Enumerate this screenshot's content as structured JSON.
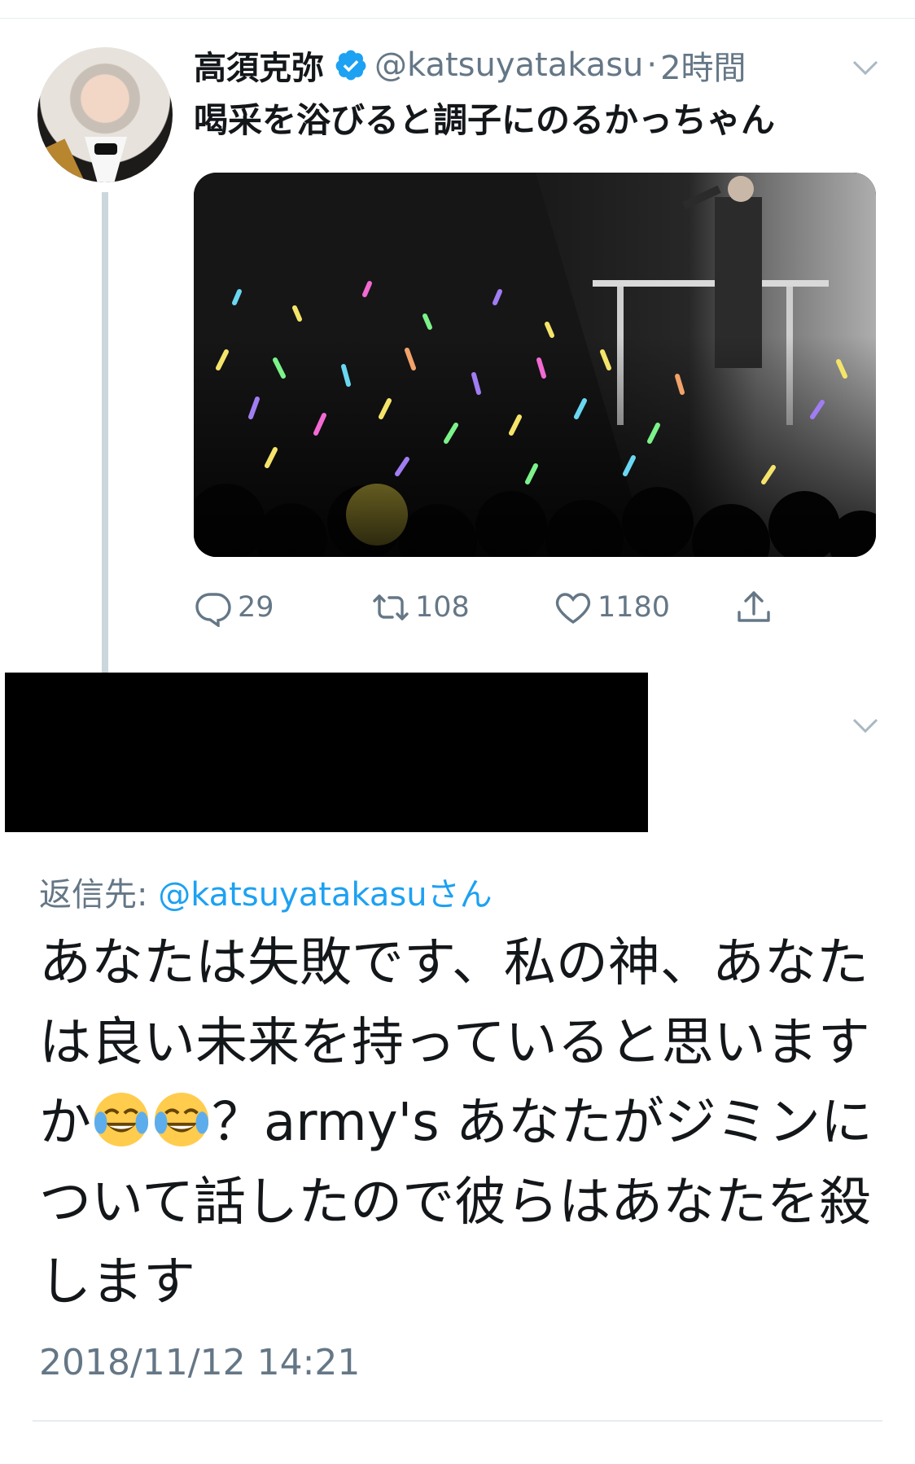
{
  "tweet": {
    "name": "高須克弥",
    "handle": "@katsuyatakasu",
    "separator": "·",
    "time": "2時間",
    "text": "喝采を浴びると調子にのるかっちゃん",
    "avatar_icon": "profile-photo",
    "media_alt_icon": "concert-photo",
    "actions": {
      "reply_count": "29",
      "retweet_count": "108",
      "like_count": "1180"
    }
  },
  "reply": {
    "replying_prefix": "返信先: ",
    "replying_to": "@katsuyatakasuさん",
    "text_before_emoji": "あなたは失敗です、私の神、あなたは良い未来を持っていると思いますか",
    "emojis": [
      "face-with-tears-of-joy",
      "face-with-tears-of-joy"
    ],
    "text_after_emoji": "？army's あなたがジミンについて話したので彼らはあなたを殺します",
    "timestamp": "2018/11/12 14:21"
  },
  "colors": {
    "accent": "#1da1f2",
    "muted": "#657786",
    "text": "#14171a",
    "divider": "#e6ecf0"
  }
}
